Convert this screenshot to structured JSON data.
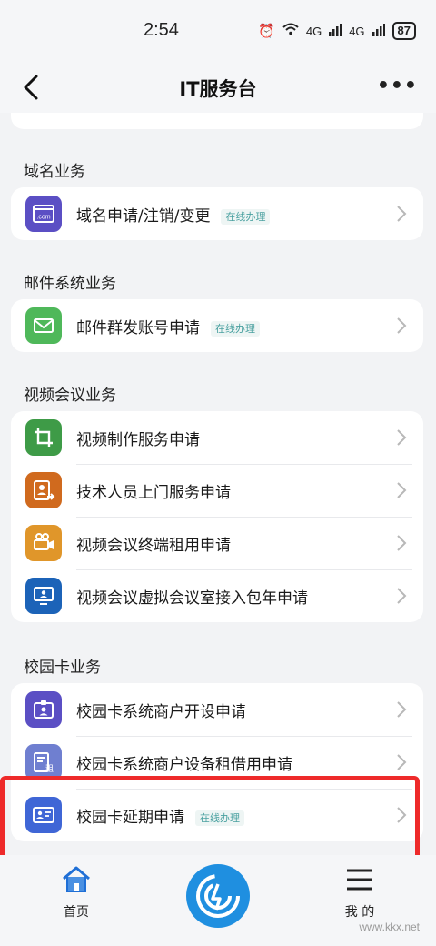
{
  "status_bar": {
    "time": "2:54",
    "signal1": "4G",
    "signal2": "4G",
    "battery": "87"
  },
  "nav": {
    "title": "IT服务台"
  },
  "badge_text": "在线办理",
  "sections": {
    "domain": {
      "title": "域名业务",
      "items": [
        {
          "label": "域名申请/注销/变更",
          "badge": "在线办理"
        }
      ]
    },
    "mail": {
      "title": "邮件系统业务",
      "items": [
        {
          "label": "邮件群发账号申请",
          "badge": "在线办理"
        }
      ]
    },
    "video": {
      "title": "视频会议业务",
      "items": [
        {
          "label": "视频制作服务申请"
        },
        {
          "label": "技术人员上门服务申请"
        },
        {
          "label": "视频会议终端租用申请"
        },
        {
          "label": "视频会议虚拟会议室接入包年申请"
        }
      ]
    },
    "campus": {
      "title": "校园卡业务",
      "items": [
        {
          "label": "校园卡系统商户开设申请"
        },
        {
          "label": "校园卡系统商户设备租借用申请"
        },
        {
          "label": "校园卡延期申请",
          "badge": "在线办理"
        }
      ]
    }
  },
  "icon_colors": {
    "domain": "#5b4fc4",
    "mail": "#4fb85a",
    "video_make": "#3e9b47",
    "tech_visit": "#d06a1e",
    "terminal": "#e0962a",
    "virtual_room": "#1c63b8",
    "merchant_open": "#5b4fc4",
    "device_rent": "#6f7fd0",
    "card_extend": "#3f66d6",
    "top_partial": "#6c93e8"
  },
  "tab_bar": {
    "home_label": "首页",
    "mine_label": "我 的"
  },
  "highlight_color": "#ee2a2a",
  "watermark": "www.kkx.net"
}
